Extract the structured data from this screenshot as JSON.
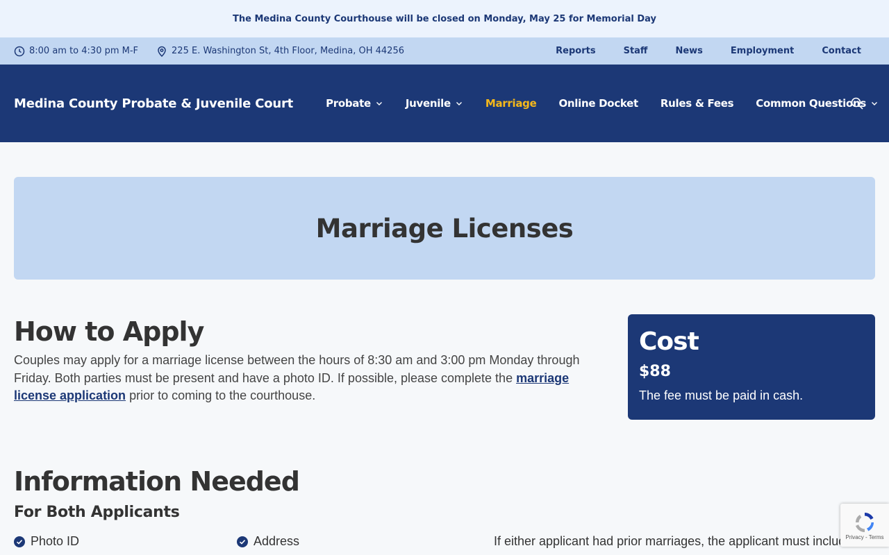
{
  "alert": {
    "text": "The Medina County Courthouse will be closed on Monday, May 25 for Memorial Day"
  },
  "info_bar": {
    "hours": "8:00 am to 4:30 pm M-F",
    "address": "225 E. Washington St, 4th Floor, Medina, OH 44256",
    "links": [
      "Reports",
      "Staff",
      "News",
      "Employment",
      "Contact"
    ]
  },
  "nav": {
    "site_title": "Medina County Probate & Juvenile Court",
    "items": [
      {
        "label": "Probate",
        "dropdown": true
      },
      {
        "label": "Juvenile",
        "dropdown": true
      },
      {
        "label": "Marriage",
        "active": true
      },
      {
        "label": "Online Docket"
      },
      {
        "label": "Rules & Fees"
      },
      {
        "label": "Common Questions",
        "dropdown": true
      }
    ],
    "search_icon": "search-icon"
  },
  "hero": {
    "title": "Marriage Licenses"
  },
  "apply": {
    "heading": "How to Apply",
    "text_before": "Couples may apply for a marriage license between the hours of 8:30 am and 3:00 pm Monday through Friday. Both parties must be present and have a photo ID. If possible, please complete the ",
    "link": "marriage license application",
    "text_after": " prior to coming to the courthouse."
  },
  "cost": {
    "title": "Cost",
    "price": "$88",
    "note": "The fee must be paid in cash."
  },
  "info_needed": {
    "heading": "Information Needed",
    "subheading": "For Both Applicants",
    "items": [
      "Photo ID",
      "Address"
    ],
    "prior_text": "If either applicant had prior marriages, the applicant must include"
  },
  "recaptcha": {
    "terms": "Privacy - Terms"
  },
  "colors": {
    "navy": "#1c3876",
    "light_blue": "#c2d7f2",
    "gold": "#f5b81b"
  }
}
